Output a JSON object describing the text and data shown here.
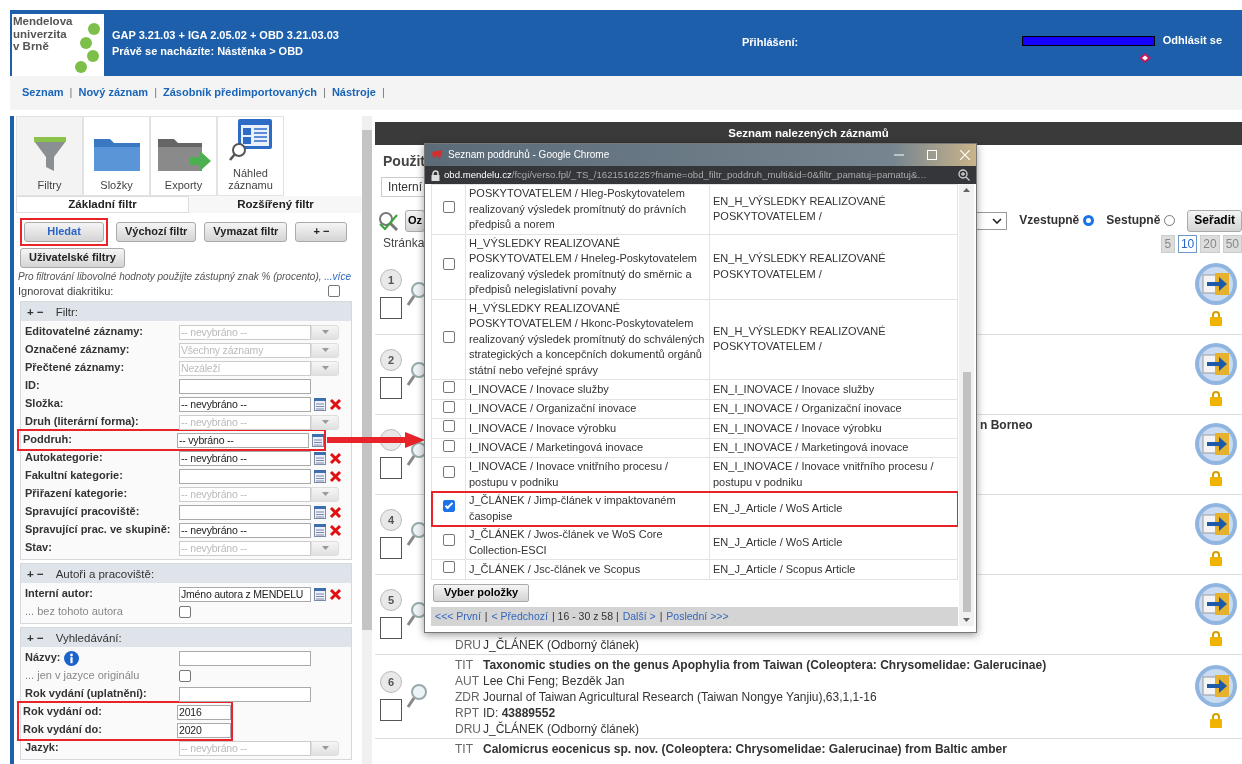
{
  "header": {
    "logo_lines": [
      "Mendelova",
      "univerzita",
      "v Brně"
    ],
    "version": "GAP 3.21.03 + IGA 2.05.02 + OBD 3.21.03.03",
    "breadcrumb": "Právě se nacházíte: Nástěnka  >  OBD",
    "login_label": "Přihlášení:",
    "logout": "Odhlásit se"
  },
  "nav": {
    "separator": "|",
    "links": [
      "Seznam",
      "Nový záznam",
      "Zásobník předimportovaných",
      "Nástroje"
    ]
  },
  "tools": [
    {
      "label": "Filtry"
    },
    {
      "label": "Složky"
    },
    {
      "label": "Exporty"
    },
    {
      "label": "Náhled záznamu"
    }
  ],
  "tabs": [
    {
      "label": "Základní filtr",
      "selected": false
    },
    {
      "label": "Rozšířený filtr",
      "selected": true
    }
  ],
  "filter_buttons": [
    {
      "label": "Hledat",
      "primary": true,
      "highlighted": true
    },
    {
      "label": "Výchozí filtr",
      "primary": false,
      "highlighted": false
    },
    {
      "label": "Vymazat filtr",
      "primary": false,
      "highlighted": false
    },
    {
      "label": "+ −",
      "primary": false,
      "highlighted": false
    },
    {
      "label": "Uživatelské filtry",
      "primary": false,
      "highlighted": false
    }
  ],
  "hint": {
    "text": "Pro filtrování libovolné hodnoty použijte zástupný znak % (procento), ",
    "link": "...více"
  },
  "ignore_diacritics": {
    "label": "Ignorovat diakritiku:",
    "checked": false
  },
  "sections": [
    {
      "toggle": "+ −",
      "title": "Filtr:",
      "rows": [
        {
          "kind": "select",
          "label": "Editovatelné záznamy:",
          "value": "-- nevybráno --",
          "highlighted": false
        },
        {
          "kind": "select",
          "label": "Označené záznamy:",
          "value": "Všechny záznamy",
          "highlighted": false
        },
        {
          "kind": "select",
          "label": "Přečtené záznamy:",
          "value": "Nezáleží",
          "highlighted": false
        },
        {
          "kind": "input",
          "label": "ID:",
          "highlighted": false
        },
        {
          "kind": "picker",
          "label": "Složka:",
          "value": "-- nevybráno --",
          "clear": true,
          "highlighted": false
        },
        {
          "kind": "select",
          "label": "Druh (literární forma):",
          "value": "-- nevybráno --",
          "highlighted": false
        },
        {
          "kind": "picker",
          "label": "Poddruh:",
          "value": "-- vybráno --",
          "clear": false,
          "highlighted": true
        },
        {
          "kind": "picker",
          "label": "Autokategorie:",
          "value": "-- nevybráno --",
          "clear": true,
          "highlighted": false
        },
        {
          "kind": "picker",
          "label": "Fakultní kategorie:",
          "clear": true,
          "highlighted": false
        },
        {
          "kind": "select",
          "label": "Přiřazení kategorie:",
          "value": "-- nevybráno --",
          "highlighted": false
        },
        {
          "kind": "picker",
          "label": "Spravující pracoviště:",
          "clear": true,
          "highlighted": false
        },
        {
          "kind": "picker",
          "label": "Spravující prac. ve skupině:",
          "value": "-- nevybráno --",
          "clear": true,
          "highlighted": false
        },
        {
          "kind": "select",
          "label": "Stav:",
          "value": "-- nevybráno --",
          "highlighted": false
        }
      ]
    },
    {
      "toggle": "+ −",
      "title": "Autoři a pracoviště:",
      "rows": [
        {
          "kind": "picker",
          "label": "Interní autor:",
          "value": "Jméno autora z MENDELU",
          "clear": true,
          "highlighted": false
        },
        {
          "kind": "check",
          "label": "... bez tohoto autora",
          "checked": false,
          "highlighted": false
        }
      ]
    },
    {
      "toggle": "+ −",
      "title": "Vyhledávání:",
      "rows": [
        {
          "kind": "input",
          "label": "Názvy:",
          "info": true,
          "highlighted": false
        },
        {
          "kind": "check",
          "label": "... jen v jazyce originálu",
          "checked": false,
          "highlighted": false
        },
        {
          "kind": "input",
          "label": "Rok vydání (uplatnění):",
          "highlighted": false
        },
        {
          "kind": "short",
          "label": "Rok vydání od:",
          "value": "2016",
          "highlighted": true
        },
        {
          "kind": "short",
          "label": "Rok vydání do:",
          "value": "2020",
          "highlighted": true
        },
        {
          "kind": "select",
          "label": "Jazyk:",
          "value": "-- nevybráno --",
          "highlighted": false
        }
      ]
    }
  ],
  "pointer_arrow": true,
  "results": {
    "title": "Seznam nalezených záznamů",
    "used_heading": "Použit",
    "used_input": "Interní",
    "button_partial": "Oz",
    "sort_options": [
      {
        "label": "Vzestupně",
        "selected": true
      },
      {
        "label": "Sestupně",
        "selected": false
      }
    ],
    "sort_button": "Seřadit",
    "page_label": "Stránka",
    "page_sizes": [
      {
        "label": "5",
        "selected": false
      },
      {
        "label": "10",
        "selected": true
      },
      {
        "label": "20",
        "selected": false
      },
      {
        "label": "50",
        "selected": false
      }
    ],
    "records": [
      {
        "number": "1",
        "checked": false,
        "actions": true
      },
      {
        "number": "2",
        "checked": false,
        "actions": true
      },
      {
        "checked": false,
        "actions": true,
        "tail": "n Borneo"
      },
      {
        "number": "4",
        "checked": false,
        "actions": true
      },
      {
        "number": "5",
        "checked": false,
        "actions": true,
        "lines": [
          {
            "tag": "DRU",
            "text": "J_ČLÁNEK  (Odborný článek)",
            "bold": false
          }
        ]
      },
      {
        "number": "6",
        "checked": false,
        "actions": true,
        "lines": [
          {
            "tag": "TIT",
            "text": "Taxonomic studies on the genus Apophylia from Taiwan (Coleoptera: Chrysomelidae: Galerucinae)",
            "bold": true
          },
          {
            "tag": "AUT",
            "text": "Lee Chi Feng; Bezděk Jan",
            "bold": false
          },
          {
            "tag": "ZDR",
            "text": "Journal of Taiwan Agricultural Research (Taiwan Nongye Yanjiu),63,1,1-16",
            "bold": false
          },
          {
            "tag": "RPT",
            "text": "ID: **43889552**",
            "bold": false
          },
          {
            "tag": "DRU",
            "text": "J_ČLÁNEK  (Odborný článek)",
            "bold": false
          }
        ]
      },
      {
        "actions": false,
        "lines": [
          {
            "tag": "TIT",
            "text": "Calomicrus eocenicus sp. nov. (Coleoptera: Chrysomelidae: Galerucinae) from Baltic amber",
            "bold": true
          }
        ]
      }
    ]
  },
  "popup": {
    "title": "Seznam poddruhů - Google Chrome",
    "url_host": "obd.mendelu.cz",
    "url_path": "/fcgi/verso.fpl/_TS_/1621516225?fname=obd_filtr_poddruh_multi&id=0&filtr_pamatuj=pamatuj&…",
    "rows": [
      {
        "cz": "POSKYTOVATELEM / Hleg-Poskytovatelem realizovaný výsledek promítnutý do právních předpisů a norem",
        "en": "EN_H_VÝSLEDKY REALIZOVANÉ POSKYTOVATELEM /",
        "checked": false,
        "highlighted": false
      },
      {
        "cz": "H_VÝSLEDKY REALIZOVANÉ POSKYTOVATELEM / Hneleg-Poskytovatelem realizovaný výsledek promítnutý do směrnic a předpisů nelegislativní povahy",
        "en": "EN_H_VÝSLEDKY REALIZOVANÉ POSKYTOVATELEM /",
        "checked": false,
        "highlighted": false
      },
      {
        "cz": "H_VÝSLEDKY REALIZOVANÉ POSKYTOVATELEM / Hkonc-Poskytovatelem realizovaný výsledek promítnutý do schválených strategických a koncepčních dokumentů orgánů státní nebo veřejné správy",
        "en": "EN_H_VÝSLEDKY REALIZOVANÉ POSKYTOVATELEM /",
        "checked": false,
        "highlighted": false
      },
      {
        "cz": "I_INOVACE / Inovace služby",
        "en": "EN_I_INOVACE / Inovace služby",
        "checked": false,
        "highlighted": false
      },
      {
        "cz": "I_INOVACE / Organizační inovace",
        "en": "EN_I_INOVACE / Organizační inovace",
        "checked": false,
        "highlighted": false
      },
      {
        "cz": "I_INOVACE / Inovace výrobku",
        "en": "EN_I_INOVACE / Inovace výrobku",
        "checked": false,
        "highlighted": false
      },
      {
        "cz": "I_INOVACE / Marketingová inovace",
        "en": "EN_I_INOVACE / Marketingová inovace",
        "checked": false,
        "highlighted": false
      },
      {
        "cz": "I_INOVACE / Inovace vnitřního procesu / postupu v podniku",
        "en": "EN_I_INOVACE / Inovace vnitřního procesu / postupu v podniku",
        "checked": false,
        "highlighted": false
      },
      {
        "cz": "J_ČLÁNEK / Jimp-článek v impaktovaném časopise",
        "en": "EN_J_Article / WoS Article",
        "checked": true,
        "highlighted": true
      },
      {
        "cz": "J_ČLÁNEK / Jwos-článek ve WoS Core Collection-ESCI",
        "en": "EN_J_Article / WoS Article",
        "checked": false,
        "highlighted": false
      },
      {
        "cz": "J_ČLÁNEK / Jsc-článek ve Scopus",
        "en": "EN_J_Article / Scopus Article",
        "checked": false,
        "highlighted": false
      }
    ],
    "button": "Vyber položky",
    "pager": [
      {
        "text": "<<< První",
        "link": true
      },
      {
        "text": "|",
        "link": false
      },
      {
        "text": "< Předchozí",
        "link": true
      },
      {
        "text": "| 16 - 30 z 58 |",
        "link": false
      },
      {
        "text": "Další >",
        "link": true
      },
      {
        "text": "|",
        "link": false
      },
      {
        "text": "Poslední >>>",
        "link": true
      }
    ]
  }
}
